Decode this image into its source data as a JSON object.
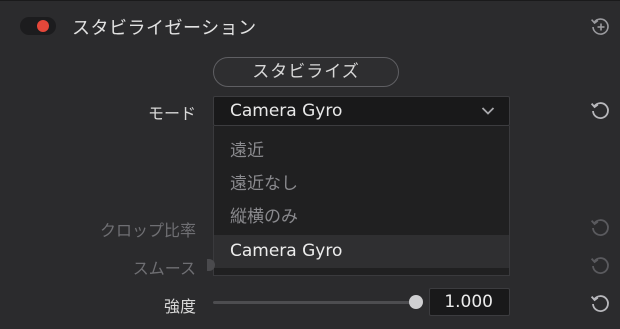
{
  "section": {
    "title": "スタビライゼーション",
    "enabled": true,
    "toggle_color": "#e5473a"
  },
  "stabilize_button": {
    "label": "スタビライズ"
  },
  "mode": {
    "label": "モード",
    "selected": "Camera Gyro",
    "options": [
      "遠近",
      "遠近なし",
      "縦横のみ",
      "Camera Gyro"
    ],
    "selected_index": 3
  },
  "crop_ratio": {
    "label": "クロップ比率"
  },
  "smoothing": {
    "label": "スムース"
  },
  "strength": {
    "label": "強度",
    "value": "1.000",
    "slider_fraction": 1.0
  },
  "icons": {
    "header_reset": "reset-plus-icon",
    "row_reset": "reset-icon",
    "dropdown_arrow": "chevron-down-icon"
  }
}
